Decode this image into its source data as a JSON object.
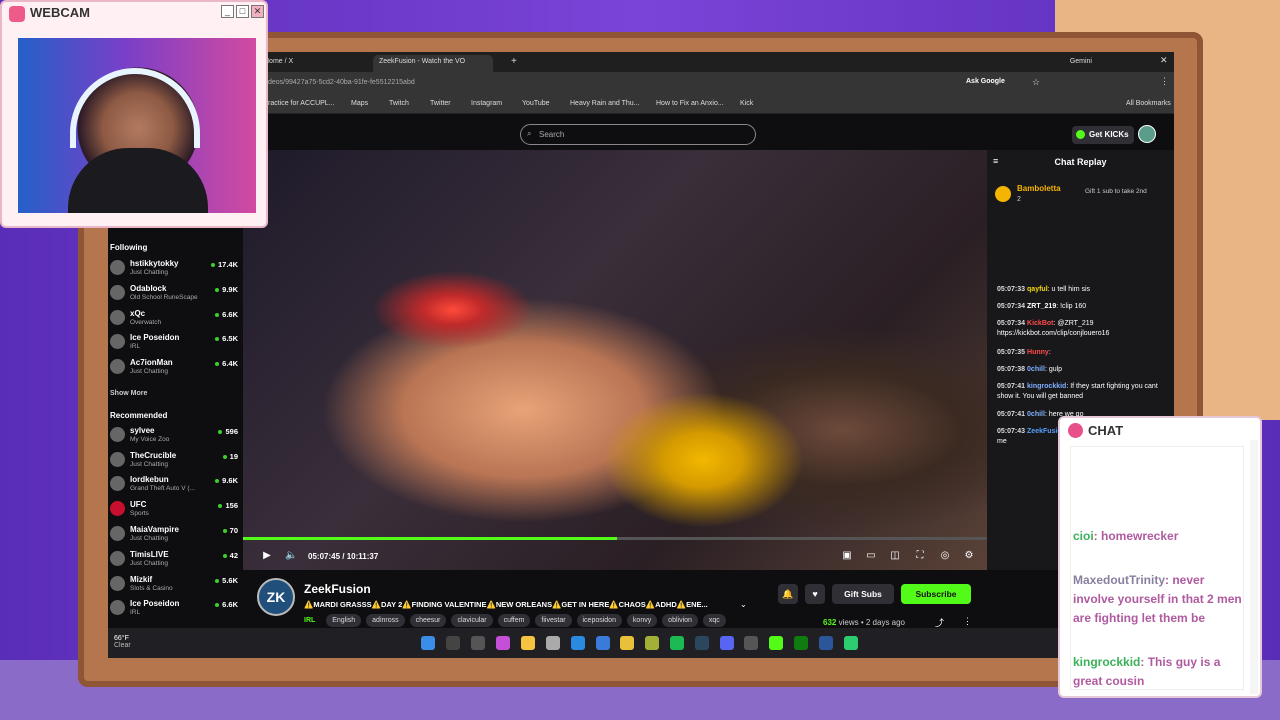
{
  "webcam": {
    "title": "WEBCAM"
  },
  "browser": {
    "tabs": [
      {
        "label": "Home / X"
      },
      {
        "label": "ZeekFusion - Watch the VO"
      },
      {
        "label": "Gemini"
      }
    ],
    "url": "deos/99427a75-5cd2-40ba-91fe-fe5512215abd",
    "ask_google": "Ask Google",
    "bookmarks": [
      "ractice for ACCUPL...",
      "Maps",
      "Twitch",
      "Twitter",
      "Instagram",
      "YouTube",
      "Heavy Rain and Thu...",
      "How to Fix an Anxio...",
      "Kick"
    ],
    "all_bookmarks": "All Bookmarks"
  },
  "site": {
    "search_placeholder": "Search",
    "get_kicks": "Get KICKs"
  },
  "sidebar": {
    "following_label": "Following",
    "following": [
      {
        "name": "hstikkytokky",
        "category": "Just Chatting",
        "viewers": "17.4K"
      },
      {
        "name": "Odablock",
        "category": "Old School RuneScape",
        "viewers": "9.9K"
      },
      {
        "name": "xQc",
        "category": "Overwatch",
        "viewers": "6.6K"
      },
      {
        "name": "Ice Poseidon",
        "category": "IRL",
        "viewers": "6.5K"
      },
      {
        "name": "Ac7ionMan",
        "category": "Just Chatting",
        "viewers": "6.4K"
      }
    ],
    "show_more": "Show More",
    "recommended_label": "Recommended",
    "recommended": [
      {
        "name": "sylvee",
        "category": "My Voice Zoo",
        "viewers": "596"
      },
      {
        "name": "TheCrucible",
        "category": "Just Chatting",
        "viewers": "19"
      },
      {
        "name": "lordkebun",
        "category": "Grand Theft Auto V (...",
        "viewers": "9.6K"
      },
      {
        "name": "UFC",
        "category": "Sports",
        "viewers": "156"
      },
      {
        "name": "MaiaVampire",
        "category": "Just Chatting",
        "viewers": "70"
      },
      {
        "name": "TimisLIVE",
        "category": "Just Chatting",
        "viewers": "42"
      },
      {
        "name": "Mizkif",
        "category": "Slots & Casino",
        "viewers": "5.6K"
      },
      {
        "name": "Ice Poseidon",
        "category": "IRL",
        "viewers": "6.6K"
      }
    ]
  },
  "player": {
    "time": "05:07:45 / 10:11:37",
    "progress": 0.503
  },
  "stream": {
    "avatar_text": "ZK",
    "name": "ZeekFusion",
    "title": "⚠️MARDI GRASSS⚠️DAY 2⚠️FINDING VALENTINE⚠️NEW ORLEANS⚠️GET IN HERE⚠️CHAOS⚠️ADHD⚠️ENE...",
    "category": "IRL",
    "tags": [
      "English",
      "adinross",
      "cheesur",
      "clavicular",
      "cuffem",
      "fiivestar",
      "iceposidon",
      "konvy",
      "oblivion",
      "xqc"
    ],
    "gift_subs": "Gift Subs",
    "subscribe": "Subscribe",
    "views": "632",
    "views_label": "views",
    "ago": "• 2 days ago"
  },
  "chat_replay": {
    "title": "Chat Replay",
    "pinned_user": "Bamboletta",
    "pinned_count": "2",
    "pinned_text": "Gift 1 sub to take 2nd",
    "messages": [
      {
        "time": "05:07:33",
        "user": "qayful",
        "user_color": "#f5d90a",
        "text": ": u tell him sis"
      },
      {
        "time": "05:07:34",
        "user": "ZRT_219",
        "user_color": "#ffffff",
        "text": ": !clip 160"
      },
      {
        "time": "05:07:34",
        "user": "KickBot",
        "user_color": "#ff4b4b",
        "text": ": @ZRT_219 https://kickbot.com/clip/conjlouero16"
      },
      {
        "time": "05:07:35",
        "user": "Hunny",
        "user_color": "#ff4b4b",
        "text": ":"
      },
      {
        "time": "05:07:38",
        "user": "0chill",
        "user_color": "#7fb0ff",
        "text": ": gulp"
      },
      {
        "time": "05:07:41",
        "user": "kingrockkid",
        "user_color": "#7fb0ff",
        "text": ": If they start fighting you cant show it. You will get banned"
      },
      {
        "time": "05:07:41",
        "user": "0chill",
        "user_color": "#7fb0ff",
        "text": ": here we go"
      },
      {
        "time": "05:07:43",
        "user": "ZeekFusion",
        "user_color": "#53a0ff",
        "text": ": dmw i love you dont do that to me"
      }
    ]
  },
  "taskbar": {
    "temp": "66°F",
    "weather": "Clear"
  },
  "overlay_chat": {
    "title": "CHAT",
    "messages": [
      {
        "user": "cioi",
        "text": ": homewrecker"
      },
      {
        "user": "MaxedoutTrinity",
        "text": ": never involve yourself in that 2 men are fighting let them be"
      },
      {
        "user": "kingrockkid",
        "text": ": This guy is a great cousin"
      }
    ]
  },
  "colors": {
    "kick_green": "#53fc18",
    "page_bg": "#0e0e10",
    "chat_bg": "#18181b"
  }
}
